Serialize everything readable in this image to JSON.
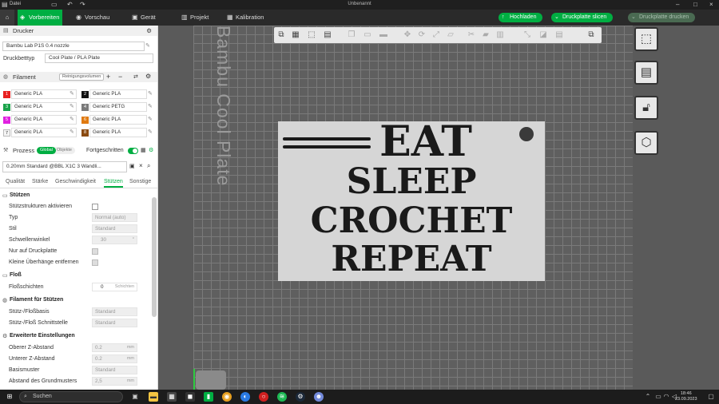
{
  "window": {
    "title": "Unbenannt",
    "menu": "Datei"
  },
  "tabs": [
    {
      "label": "Vorbereiten",
      "icon": "cube-icon"
    },
    {
      "label": "Vorschau",
      "icon": "eye-icon"
    },
    {
      "label": "Gerät",
      "icon": "device-icon"
    },
    {
      "label": "Projekt",
      "icon": "project-icon"
    },
    {
      "label": "Kalibration",
      "icon": "calibration-icon"
    }
  ],
  "actions": {
    "upload": "Hochladen",
    "slice": "Druckplatte slicen",
    "print": "Druckplatte drucken"
  },
  "printer": {
    "section": "Drucker",
    "model": "Bambu Lab P1S 0.4 nozzle",
    "bed_label": "Druckbetttyp",
    "bed_value": "Cool Plate / PLA Plate"
  },
  "filament": {
    "section": "Filament",
    "purge_button": "Reinigungsvolumen",
    "slots": [
      {
        "num": "1",
        "name": "Generic PLA",
        "color": "#e82020"
      },
      {
        "num": "2",
        "name": "Generic PLA",
        "color": "#111111"
      },
      {
        "num": "3",
        "name": "Generic PLA",
        "color": "#1aa34a"
      },
      {
        "num": "4",
        "name": "Generic PETG",
        "color": "#7a7a7a"
      },
      {
        "num": "5",
        "name": "Generic PLA",
        "color": "#e020e0"
      },
      {
        "num": "6",
        "name": "Generic PLA",
        "color": "#e07a10"
      },
      {
        "num": "7",
        "name": "Generic PLA",
        "color": "#f4f4f4"
      },
      {
        "num": "8",
        "name": "Generic PLA",
        "color": "#8a4a10"
      }
    ]
  },
  "process": {
    "section": "Prozess",
    "toggle_global": "Global",
    "toggle_object": "Objekte",
    "advanced": "Fortgeschritten",
    "preset": "0.20mm Standard @BBL X1C 3 Wandli...",
    "tabs": [
      "Qualität",
      "Stärke",
      "Geschwindigkeit",
      "Stützen",
      "Sonstige"
    ],
    "active_tab": "Stützen"
  },
  "settings": {
    "support_group": "Stützen",
    "support_enable": "Stützstrukturen aktivieren",
    "type_label": "Typ",
    "type_value": "Normal (auto)",
    "style_label": "Stil",
    "style_value": "Standard",
    "threshold_label": "Schwellenwinkel",
    "threshold_value": "30",
    "threshold_unit": "°",
    "build_plate_only": "Nur auf Druckplatte",
    "remove_small": "Kleine Überhänge entfernen",
    "raft_group": "Floß",
    "raft_layers_label": "Floßschichten",
    "raft_layers_value": "0",
    "raft_layers_unit": "Schichten",
    "filament_group": "Filament für Stützen",
    "raft_base_label": "Stütz-/Floßbasis",
    "raft_base_value": "Standard",
    "raft_interface_label": "Stütz-/Floß Schnittstelle",
    "raft_interface_value": "Standard",
    "advanced_group": "Erweiterte Einstellungen",
    "top_z_label": "Oberer Z-Abstand",
    "top_z_value": "0.2",
    "bottom_z_label": "Unterer Z-Abstand",
    "bottom_z_value": "0.2",
    "base_pattern_label": "Basismuster",
    "base_pattern_value": "Standard",
    "base_spacing_label": "Abstand des Grundmusters",
    "base_spacing_value": "2,5",
    "unit_mm": "mm"
  },
  "viewport": {
    "plate_label": "Bambu Cool Plate",
    "sign_lines": [
      "EAT",
      "SLEEP",
      "CROCHET",
      "REPEAT"
    ]
  },
  "taskbar": {
    "search": "Suchen",
    "time": "18:46",
    "date": "23.09.2023"
  }
}
